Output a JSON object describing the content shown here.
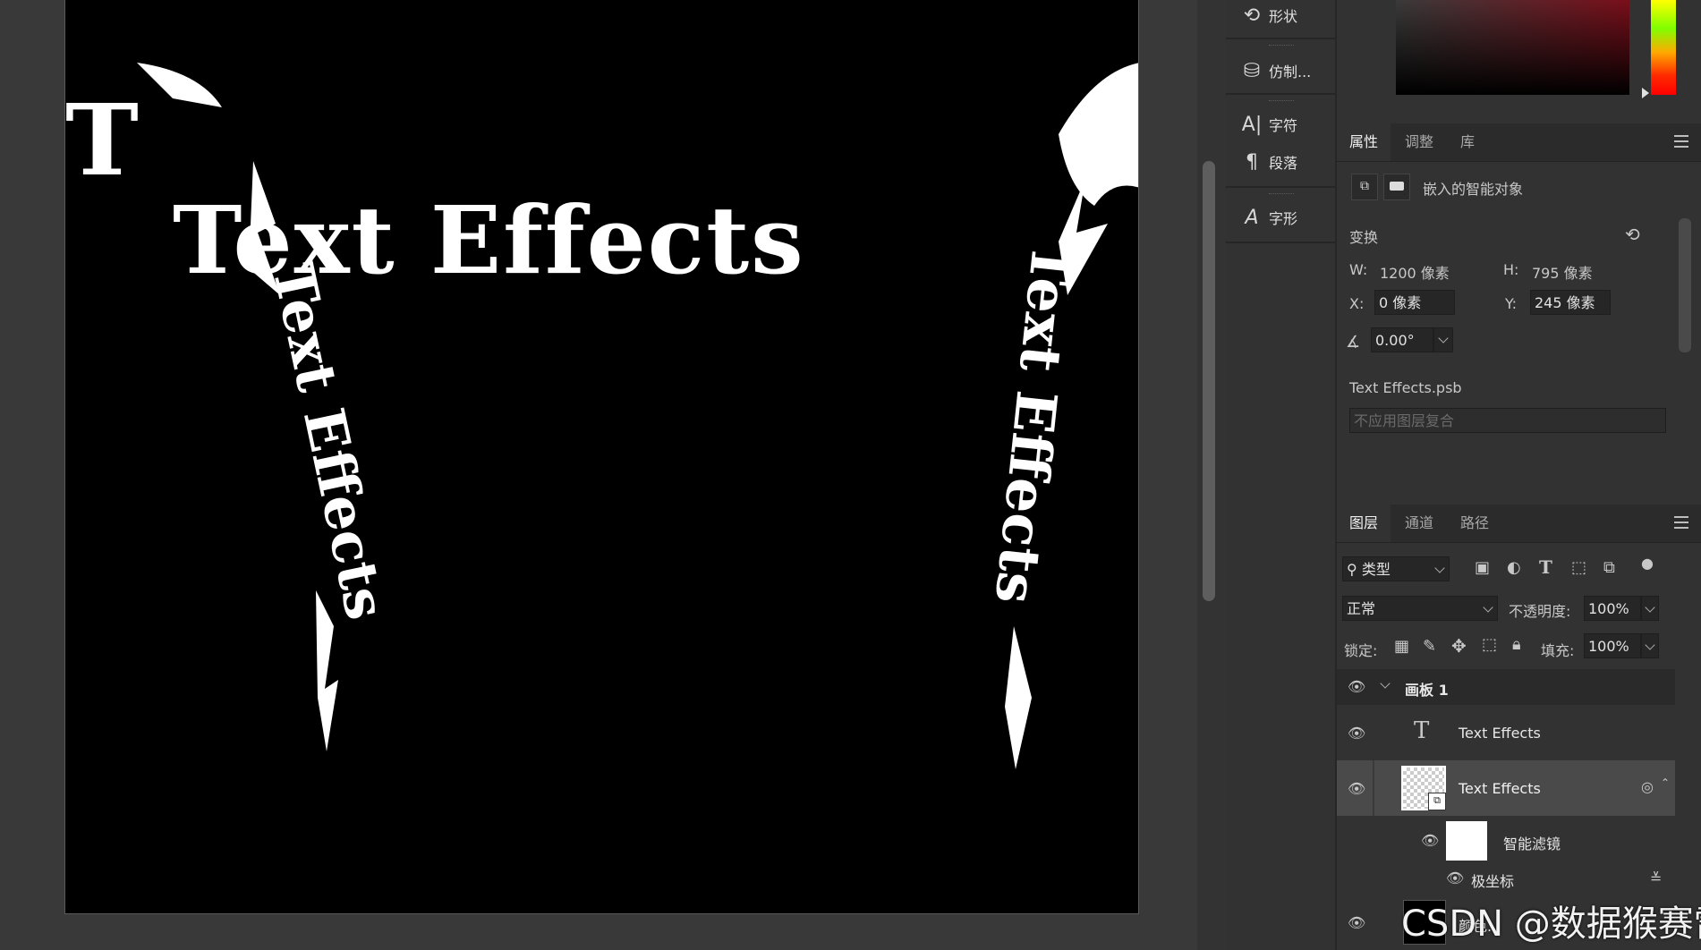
{
  "canvas": {
    "title_text": "Text Effects",
    "side_text_left": "Text Effects",
    "side_text_right": "Text Effects",
    "colors": {
      "background": "#000000",
      "text": "#ffffff"
    }
  },
  "dock": {
    "items": [
      {
        "icon": "shape-icon",
        "label": "形状"
      },
      {
        "icon": "clone-stamp-icon",
        "label": "仿制..."
      },
      {
        "icon": "character-icon",
        "label": "字符"
      },
      {
        "icon": "paragraph-icon",
        "label": "段落"
      },
      {
        "icon": "glyph-icon",
        "label": "字形"
      }
    ]
  },
  "properties_panel": {
    "tabs": [
      "属性",
      "调整",
      "库"
    ],
    "active_tab": "属性",
    "object_type": "嵌入的智能对象",
    "transform_label": "变换",
    "w_label": "W:",
    "w_value": "1200 像素",
    "h_label": "H:",
    "h_value": "795 像素",
    "x_label": "X:",
    "x_value": "0 像素",
    "y_label": "Y:",
    "y_value": "245 像素",
    "angle_value": "0.00°",
    "filename": "Text Effects.psb",
    "layer_comp_placeholder": "不应用图层复合"
  },
  "layers_panel": {
    "tabs": [
      "图层",
      "通道",
      "路径"
    ],
    "active_tab": "图层",
    "filter_label": "类型",
    "blend_mode": "正常",
    "opacity_label": "不透明度:",
    "opacity_value": "100%",
    "lock_label": "锁定:",
    "fill_label": "填充:",
    "fill_value": "100%",
    "layers": [
      {
        "type": "artboard",
        "name": "画板 1"
      },
      {
        "type": "text",
        "name": "Text Effects"
      },
      {
        "type": "smart-object",
        "name": "Text Effects"
      },
      {
        "type": "smart-filter",
        "name": "智能滤镜"
      },
      {
        "type": "filter",
        "name": "极坐标"
      },
      {
        "type": "fill",
        "name": "颜色..."
      }
    ]
  },
  "watermark": "CSDN @数据猴赛雷"
}
